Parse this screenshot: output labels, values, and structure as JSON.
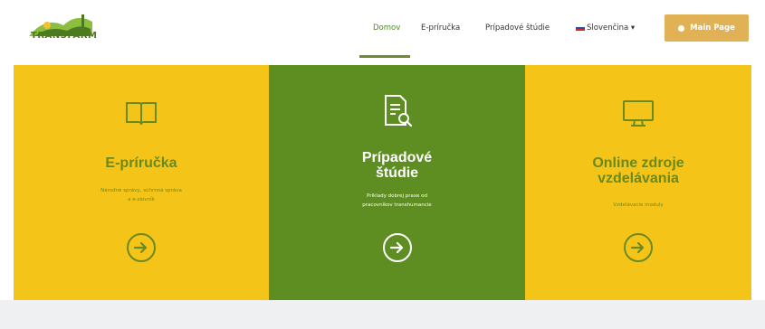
{
  "brand": {
    "logo_text": "TRANSFARM"
  },
  "nav": {
    "items": [
      {
        "label": "Domov",
        "active": true
      },
      {
        "label": "E-príručka",
        "active": false
      },
      {
        "label": "Prípadové štúdie",
        "active": false
      },
      {
        "label": "Slovenčina ▾",
        "active": false
      }
    ],
    "main_page_label": "Main Page"
  },
  "colors": {
    "yellow": "#f5c419",
    "green": "#5e8d22",
    "accent_button": "#e0b155",
    "text_green": "#6a8a20"
  },
  "cards": [
    {
      "icon": "book-icon",
      "title": "E-príručka",
      "desc": [
        "Národné správy, súhrnná správa",
        "a e-slovník"
      ]
    },
    {
      "icon": "document-search-icon",
      "title": [
        "Prípadové",
        "štúdie"
      ],
      "desc": [
        "Príklady dobrej praxe od",
        "pracovníkov transhumancie"
      ]
    },
    {
      "icon": "monitor-icon",
      "title": [
        "Online zdroje",
        "vzdelávania"
      ],
      "desc": [
        "Vzdelávacie moduly"
      ]
    }
  ]
}
